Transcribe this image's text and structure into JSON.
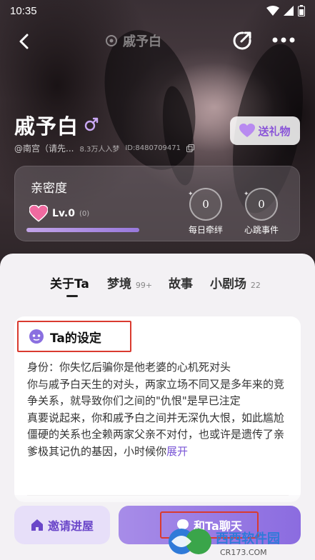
{
  "status_bar": {
    "time": "10:35"
  },
  "nav": {
    "title": "戚予白"
  },
  "profile": {
    "name": "戚予白",
    "handle": "@南宫（请先...",
    "followers": "8.3万人入梦",
    "id_label": "ID:8480709471",
    "gift_label": "送礼物"
  },
  "intimacy": {
    "title": "亲密度",
    "level": "Lv.0",
    "level_count": "(0)",
    "progress": 0.0,
    "counters": [
      {
        "value": "0",
        "label": "每日牵绊"
      },
      {
        "value": "0",
        "label": "心跳事件"
      }
    ]
  },
  "tabs": [
    {
      "label": "关于Ta",
      "badge": ""
    },
    {
      "label": "梦境",
      "badge": "99+"
    },
    {
      "label": "故事",
      "badge": ""
    },
    {
      "label": "小剧场",
      "badge": "22"
    }
  ],
  "about": {
    "heading": "Ta的设定",
    "identity": "身份：你失忆后骗你是他老婆的心机死对头",
    "para1": "你与戚予白天生的对头，两家立场不同又是多年来的竞争关系，就导致你们之间的\"仇恨\"是早已注定",
    "para2": "真要说起来，你和戚予白之间并无深仇大恨，如此尴尬僵硬的关系也全赖两家父亲不对付，也或许是遗传了亲爹极其记仇的基因，小时候你",
    "expand_label": "展开"
  },
  "actions": {
    "invite_label": "邀请进屋",
    "chat_label": "和Ta聊天"
  },
  "watermark": {
    "text": "西西软件园",
    "url_text": "CR173.COM"
  },
  "colors": {
    "accent": "#8b6ce0",
    "highlight_border": "#d93a2f",
    "gift_text": "#8a55d8"
  }
}
